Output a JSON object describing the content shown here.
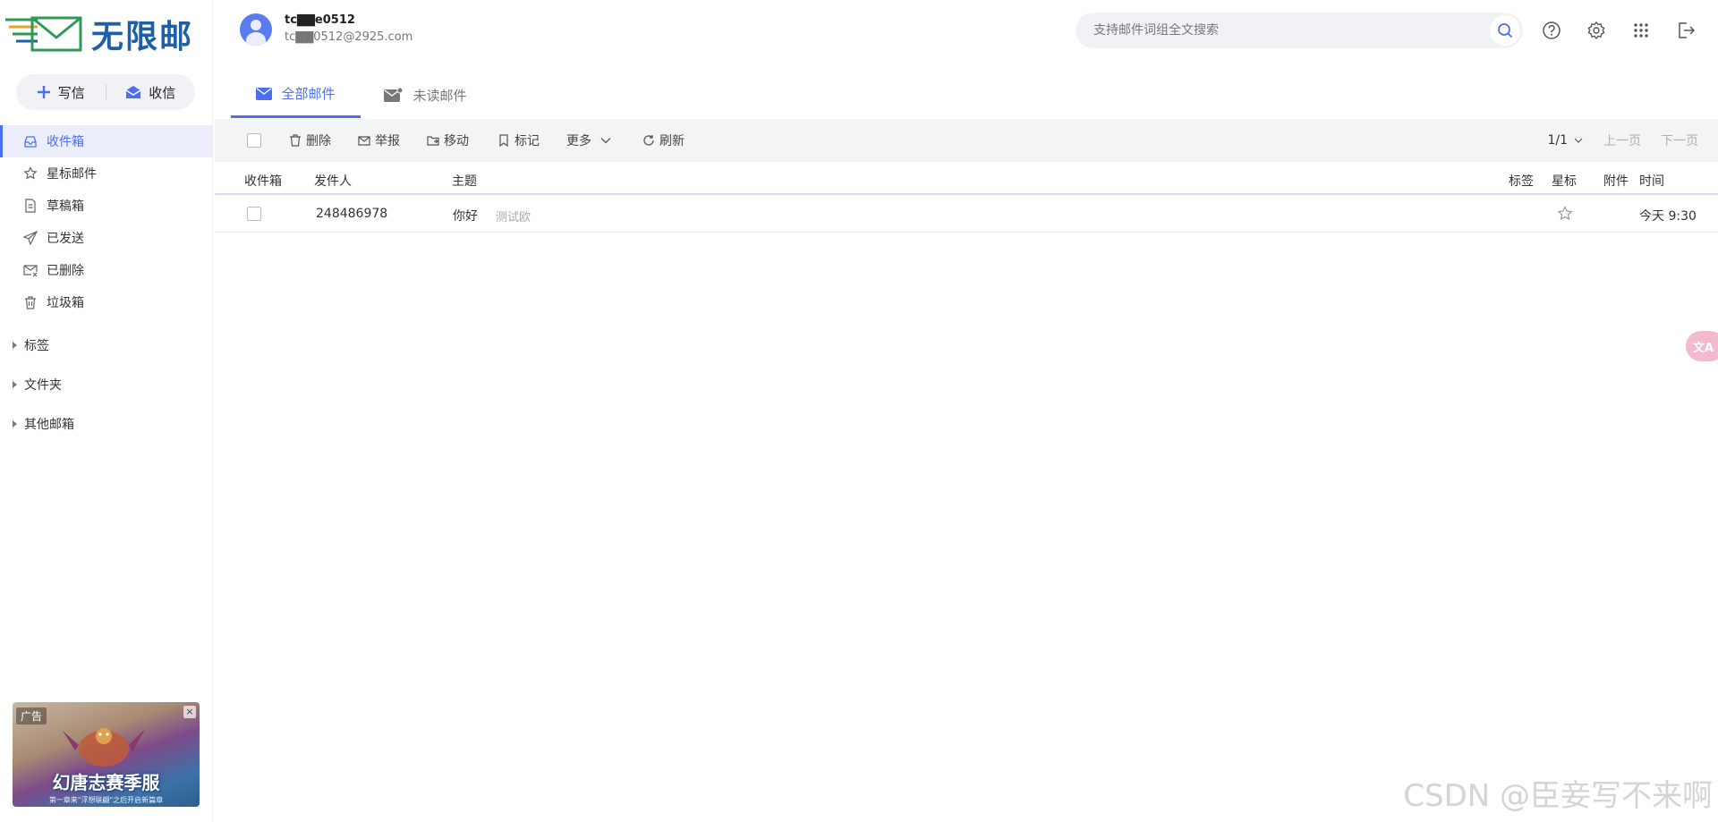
{
  "logo": {
    "text": "无限邮"
  },
  "compose": {
    "write_label": "写信",
    "receive_label": "收信"
  },
  "folders": [
    {
      "label": "收件箱",
      "icon": "inbox-icon",
      "active": true
    },
    {
      "label": "星标邮件",
      "icon": "star-icon"
    },
    {
      "label": "草稿箱",
      "icon": "draft-icon"
    },
    {
      "label": "已发送",
      "icon": "send-icon"
    },
    {
      "label": "已删除",
      "icon": "deleted-mail-icon"
    },
    {
      "label": "垃圾箱",
      "icon": "trash-icon"
    }
  ],
  "groups": [
    "标签",
    "文件夹",
    "其他邮箱"
  ],
  "ad": {
    "tag": "广告",
    "close": "×",
    "title": "幻唐志赛季服",
    "subtitle": "第一章来\"浮想联翩\"之后开启新篇章"
  },
  "user": {
    "name": "tc▇▇e0512",
    "email": "tc▇▇0512@2925.com"
  },
  "search": {
    "placeholder": "支持邮件词组全文搜索"
  },
  "tabs": [
    {
      "label": "全部邮件",
      "active": true
    },
    {
      "label": "未读邮件",
      "active": false
    }
  ],
  "toolbar": {
    "delete": "删除",
    "report": "举报",
    "move": "移动",
    "mark": "标记",
    "more": "更多",
    "refresh": "刷新",
    "page": "1/1",
    "prev": "上一页",
    "next": "下一页"
  },
  "table": {
    "headers": {
      "folder": "收件箱",
      "sender": "发件人",
      "subject": "主题",
      "tag": "标签",
      "star": "星标",
      "attachment": "附件",
      "time": "时间"
    },
    "rows": [
      {
        "sender": "248486978",
        "subject": "你好",
        "preview": "测试欧",
        "time": "今天 9:30",
        "starred": false
      }
    ]
  },
  "translate_button": "文A",
  "watermark": "CSDN @臣妾写不来啊",
  "colors": {
    "accent": "#4e6ef2",
    "logo": "#1f5fa6",
    "toolbar_bg": "#f3f4f6"
  }
}
